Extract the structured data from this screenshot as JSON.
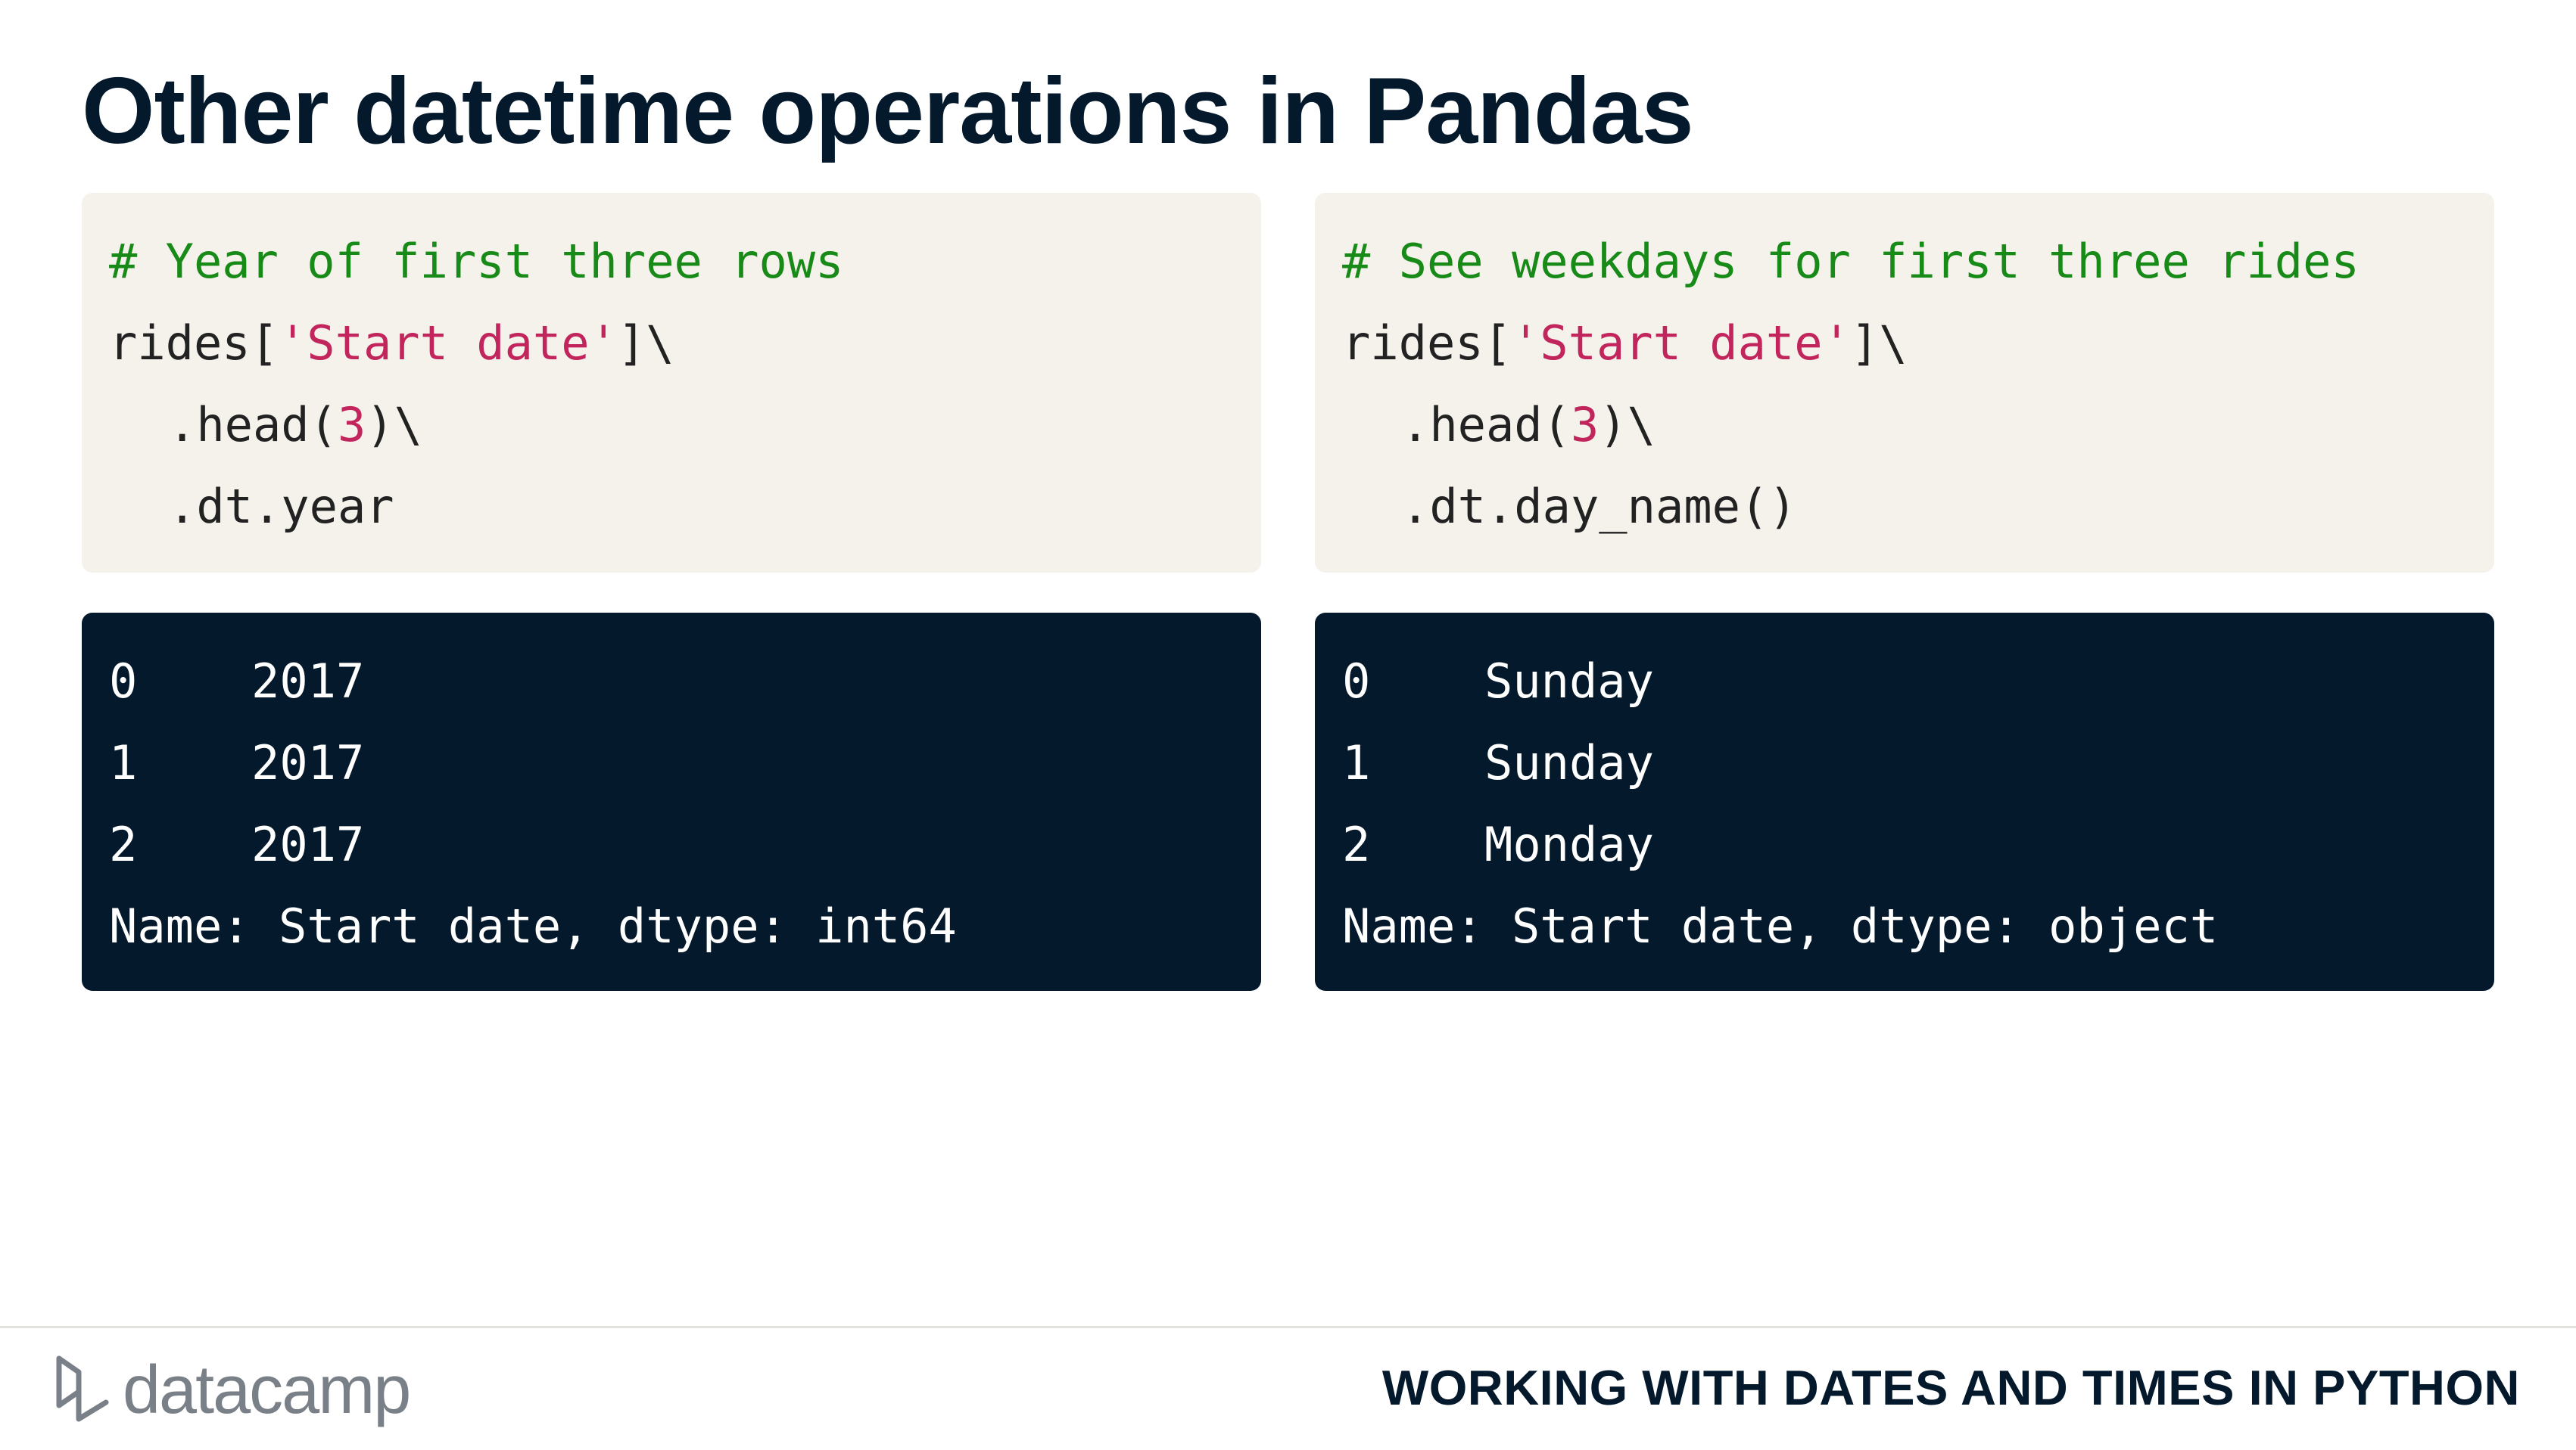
{
  "slide": {
    "title": "Other datetime operations in Pandas"
  },
  "left_example": {
    "code": {
      "comment": "# Year of first three rows",
      "line1_prefix": "rides[",
      "line1_string": "'Start date'",
      "line1_suffix": "]\\",
      "line2_prefix": ".head(",
      "line2_number": "3",
      "line2_suffix": ")\\",
      "line3": ".dt.year"
    },
    "output": {
      "rows": [
        {
          "index": "0",
          "value": "2017"
        },
        {
          "index": "1",
          "value": "2017"
        },
        {
          "index": "2",
          "value": "2017"
        }
      ],
      "footer": "Name: Start date, dtype: int64"
    }
  },
  "right_example": {
    "code": {
      "comment": "# See weekdays for first three rides",
      "line1_prefix": "rides[",
      "line1_string": "'Start date'",
      "line1_suffix": "]\\",
      "line2_prefix": ".head(",
      "line2_number": "3",
      "line2_suffix": ")\\",
      "line3": ".dt.day_name()"
    },
    "output": {
      "rows": [
        {
          "index": "0",
          "value": "Sunday"
        },
        {
          "index": "1",
          "value": "Sunday"
        },
        {
          "index": "2",
          "value": "Monday"
        }
      ],
      "footer": "Name: Start date, dtype: object"
    }
  },
  "footer": {
    "logo_text": "datacamp",
    "logo_icon": "datacamp-logo-icon",
    "course_name": "WORKING WITH DATES AND TIMES IN PYTHON"
  },
  "colors": {
    "navy": "#05192d",
    "code_background": "#f5f2ec",
    "comment": "#178a17",
    "string_literal": "#c2255c",
    "logo_gray": "#7a8088"
  }
}
